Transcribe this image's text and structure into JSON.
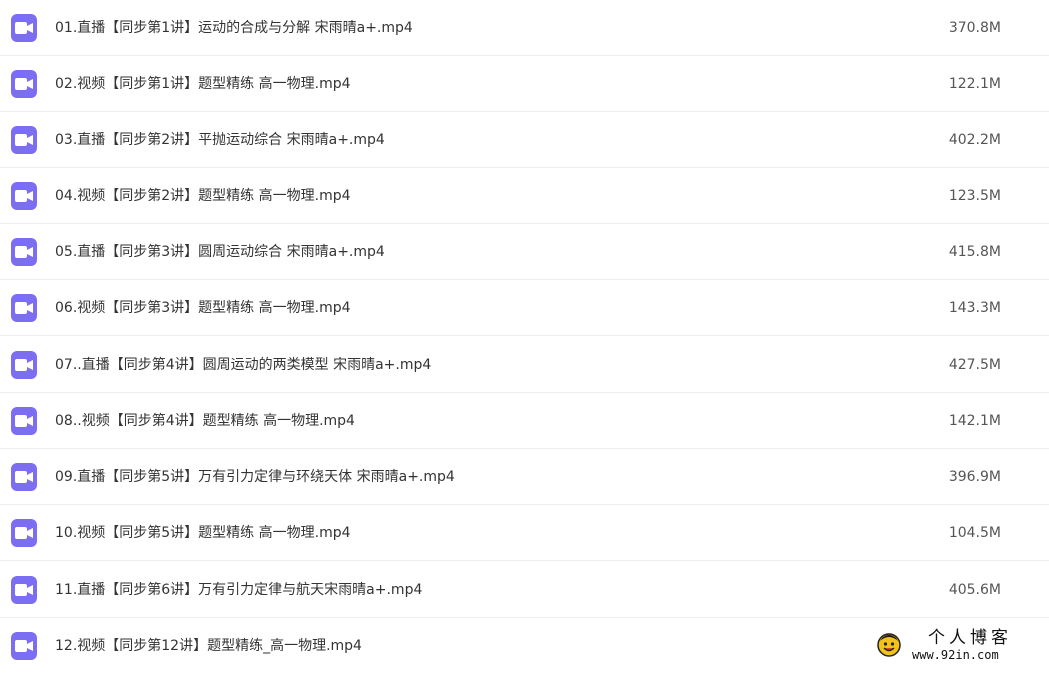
{
  "colors": {
    "video_icon": "#7b6ef2",
    "row_divider": "#eeeeee",
    "text": "#333333"
  },
  "files": [
    {
      "name": "01.直播【同步第1讲】运动的合成与分解 宋雨晴a+.mp4",
      "size": "370.8M",
      "icon": "video-file-icon"
    },
    {
      "name": "02.视频【同步第1讲】题型精练 高一物理.mp4",
      "size": "122.1M",
      "icon": "video-file-icon"
    },
    {
      "name": "03.直播【同步第2讲】平抛运动综合 宋雨晴a+.mp4",
      "size": "402.2M",
      "icon": "video-file-icon"
    },
    {
      "name": "04.视频【同步第2讲】题型精练 高一物理.mp4",
      "size": "123.5M",
      "icon": "video-file-icon"
    },
    {
      "name": "05.直播【同步第3讲】圆周运动综合 宋雨晴a+.mp4",
      "size": "415.8M",
      "icon": "video-file-icon"
    },
    {
      "name": "06.视频【同步第3讲】题型精练 高一物理.mp4",
      "size": "143.3M",
      "icon": "video-file-icon"
    },
    {
      "name": "07..直播【同步第4讲】圆周运动的两类模型 宋雨晴a+.mp4",
      "size": "427.5M",
      "icon": "video-file-icon"
    },
    {
      "name": "08..视频【同步第4讲】题型精练 高一物理.mp4",
      "size": "142.1M",
      "icon": "video-file-icon"
    },
    {
      "name": "09.直播【同步第5讲】万有引力定律与环绕天体 宋雨晴a+.mp4",
      "size": "396.9M",
      "icon": "video-file-icon"
    },
    {
      "name": "10.视频【同步第5讲】题型精练 高一物理.mp4",
      "size": "104.5M",
      "icon": "video-file-icon"
    },
    {
      "name": "11.直播【同步第6讲】万有引力定律与航天宋雨晴a+.mp4",
      "size": "405.6M",
      "icon": "video-file-icon"
    },
    {
      "name": "12.视频【同步第12讲】题型精练_高一物理.mp4",
      "size": "",
      "icon": "video-file-icon"
    }
  ],
  "watermark": {
    "title": "个人博客",
    "url": "www.92in.com",
    "logo": "smiley-face-logo"
  }
}
